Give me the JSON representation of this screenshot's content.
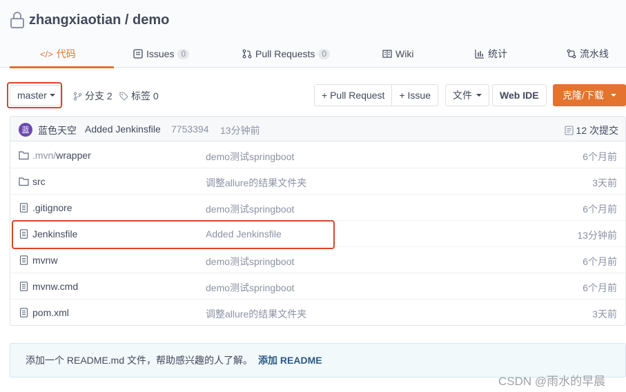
{
  "repo": {
    "title": "zhangxiaotian / demo"
  },
  "tabs": [
    {
      "label": "代码",
      "icon": "code-icon",
      "active": true
    },
    {
      "label": "Issues",
      "count": "0",
      "icon": "issues-icon"
    },
    {
      "label": "Pull Requests",
      "count": "0",
      "icon": "pull-request-icon"
    },
    {
      "label": "Wiki",
      "icon": "wiki-icon"
    },
    {
      "label": "统计",
      "icon": "bar-chart-icon"
    },
    {
      "label": "流水线",
      "icon": "pipeline-icon"
    }
  ],
  "toolbar": {
    "branch": "master",
    "branches_label": "分支 2",
    "tags_label": "标签 0",
    "pull_request_button": "+ Pull Request",
    "issue_button": "+ Issue",
    "file_button": "文件",
    "web_ide_button": "Web IDE",
    "clone_button": "克隆/下载"
  },
  "latest_commit": {
    "avatar_text": "蓝",
    "author": "蓝色天空",
    "message": "Added Jenkinsfile",
    "sha": "7753394",
    "time": "13分钟前",
    "count_label": "12 次提交"
  },
  "files": [
    {
      "type": "folder",
      "name_prefix": ".mvn/",
      "name": "wrapper",
      "message": "demo测试springboot",
      "time": "6个月前"
    },
    {
      "type": "folder",
      "name_prefix": "",
      "name": "src",
      "message": "调整allure的结果文件夹",
      "time": "3天前"
    },
    {
      "type": "file",
      "name_prefix": "",
      "name": ".gitignore",
      "message": "demo测试springboot",
      "time": "6个月前"
    },
    {
      "type": "file",
      "name_prefix": "",
      "name": "Jenkinsfile",
      "message": "Added Jenkinsfile",
      "time": "13分钟前"
    },
    {
      "type": "file",
      "name_prefix": "",
      "name": "mvnw",
      "message": "demo测试springboot",
      "time": "6个月前"
    },
    {
      "type": "file",
      "name_prefix": "",
      "name": "mvnw.cmd",
      "message": "demo测试springboot",
      "time": "6个月前"
    },
    {
      "type": "file",
      "name_prefix": "",
      "name": "pom.xml",
      "message": "调整allure的结果文件夹",
      "time": "3天前"
    }
  ],
  "readme": {
    "text": "添加一个 README.md 文件，帮助感兴趣的人了解。",
    "link": "添加 README"
  },
  "watermark": "CSDN @雨水的早晨",
  "colors": {
    "accent": "#e4732d",
    "highlight": "#d9442a",
    "avatar": "#6a4aaf"
  }
}
